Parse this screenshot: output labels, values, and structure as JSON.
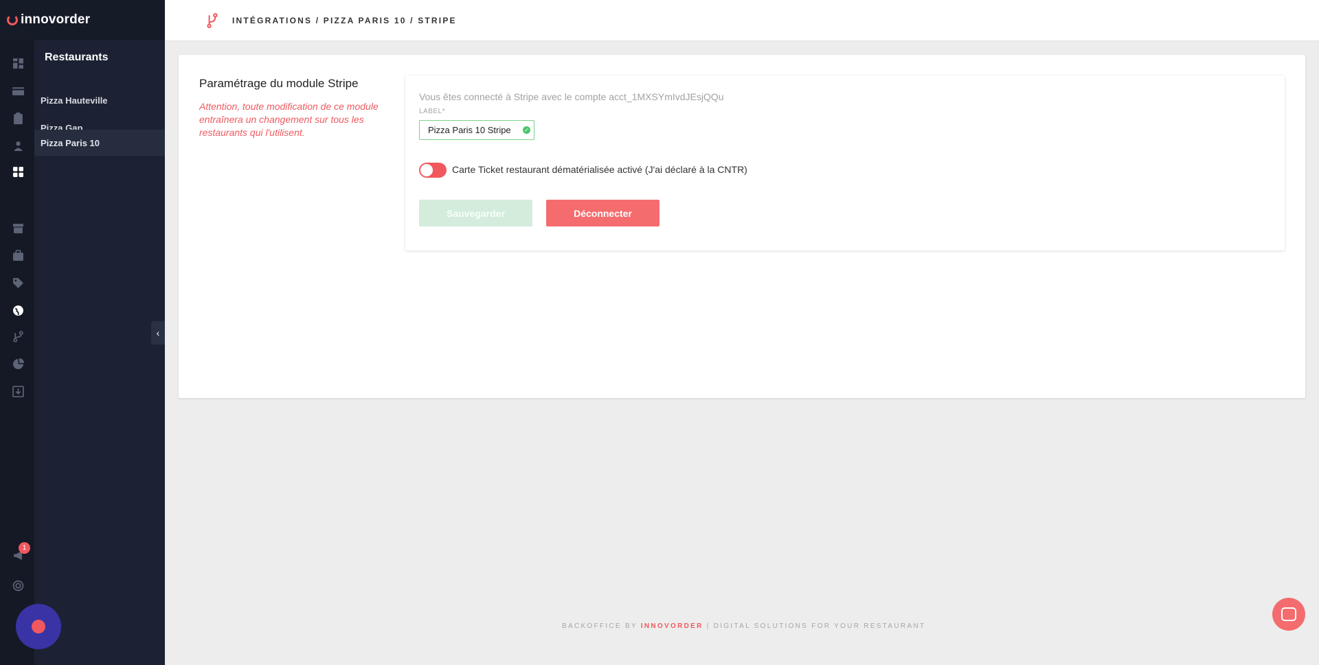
{
  "app": {
    "logo_text": "innovorder"
  },
  "sidebar": {
    "rail_icons": [
      "dashboard-icon",
      "card-icon",
      "clipboard-icon",
      "user-icon",
      "grid-icon",
      "store-icon",
      "briefcase-icon",
      "tags-icon",
      "globe-icon",
      "branch-icon",
      "pie-chart-icon",
      "download-icon",
      "megaphone-icon",
      "support-icon"
    ],
    "notification_count": "1",
    "panel_title": "Restaurants",
    "restaurants": [
      {
        "label": "Pizza Hauteville"
      },
      {
        "label": "Pizza Gap"
      },
      {
        "label": "Pizza Paris 10"
      }
    ],
    "active_restaurant": "Pizza Paris 10",
    "collapse_glyph": "‹"
  },
  "header": {
    "breadcrumb": "INTÉGRATIONS / PIZZA PARIS 10 / STRIPE"
  },
  "main": {
    "section_title": "Paramétrage du module Stripe",
    "warning": "Attention, toute modification de ce module entraînera un changement sur tous les restaurants qui l'utilisent.",
    "connected_text": "Vous êtes connecté à Stripe avec le compte acct_1MXSYmIvdJEsjQQu",
    "label_field": {
      "label": "LABEL*",
      "value": "Pizza Paris 10 Stripe"
    },
    "toggle": {
      "label": "Carte Ticket restaurant dématérialisée activé (J'ai déclaré à la CNTR)",
      "on": true
    },
    "buttons": {
      "save": "Sauvegarder",
      "disconnect": "Déconnecter"
    }
  },
  "footer": {
    "prefix": "BACKOFFICE BY",
    "brand": "INNOVORDER",
    "suffix": "| DIGITAL SOLUTIONS FOR YOUR RESTAURANT"
  },
  "colors": {
    "accent": "#f0585d",
    "sidebar_bg": "#1c2233",
    "success": "#4cc66b"
  }
}
